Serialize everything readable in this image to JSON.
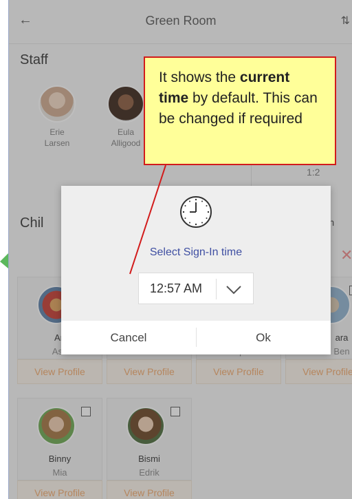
{
  "header": {
    "title": "Green Room",
    "back_icon": "arrow-left-icon",
    "sort_icon": "sort-icon"
  },
  "staff": {
    "title": "Staff",
    "members": [
      {
        "first": "Erie",
        "last": "Larsen"
      },
      {
        "first": "Eula",
        "last": "Alligood"
      }
    ],
    "ratio": "1:2"
  },
  "children": {
    "title": "Chil",
    "signed_in_label": "ed In",
    "row1": [
      {
        "first": "An",
        "last": "Ash"
      },
      {
        "first": "",
        "last": "sen"
      },
      {
        "first": "",
        "last": "Hope"
      },
      {
        "first": "ara",
        "last": "Ben"
      }
    ],
    "row2": [
      {
        "first": "Binny",
        "last": "Mia"
      },
      {
        "first": "Bismi",
        "last": "Edrik"
      }
    ],
    "view_profile": "View Profile"
  },
  "dialog": {
    "label": "Select Sign-In time",
    "time": "12:57 AM",
    "cancel": "Cancel",
    "ok": "Ok"
  },
  "callout": {
    "part1": "It shows the ",
    "bold1": "current time",
    "part2": " by default. This can be changed if required"
  },
  "colors": {
    "accent": "#3f4fa2",
    "callout_border": "#d21b1b",
    "callout_bg": "#ffff99",
    "view_profile": "#f2a86a"
  }
}
